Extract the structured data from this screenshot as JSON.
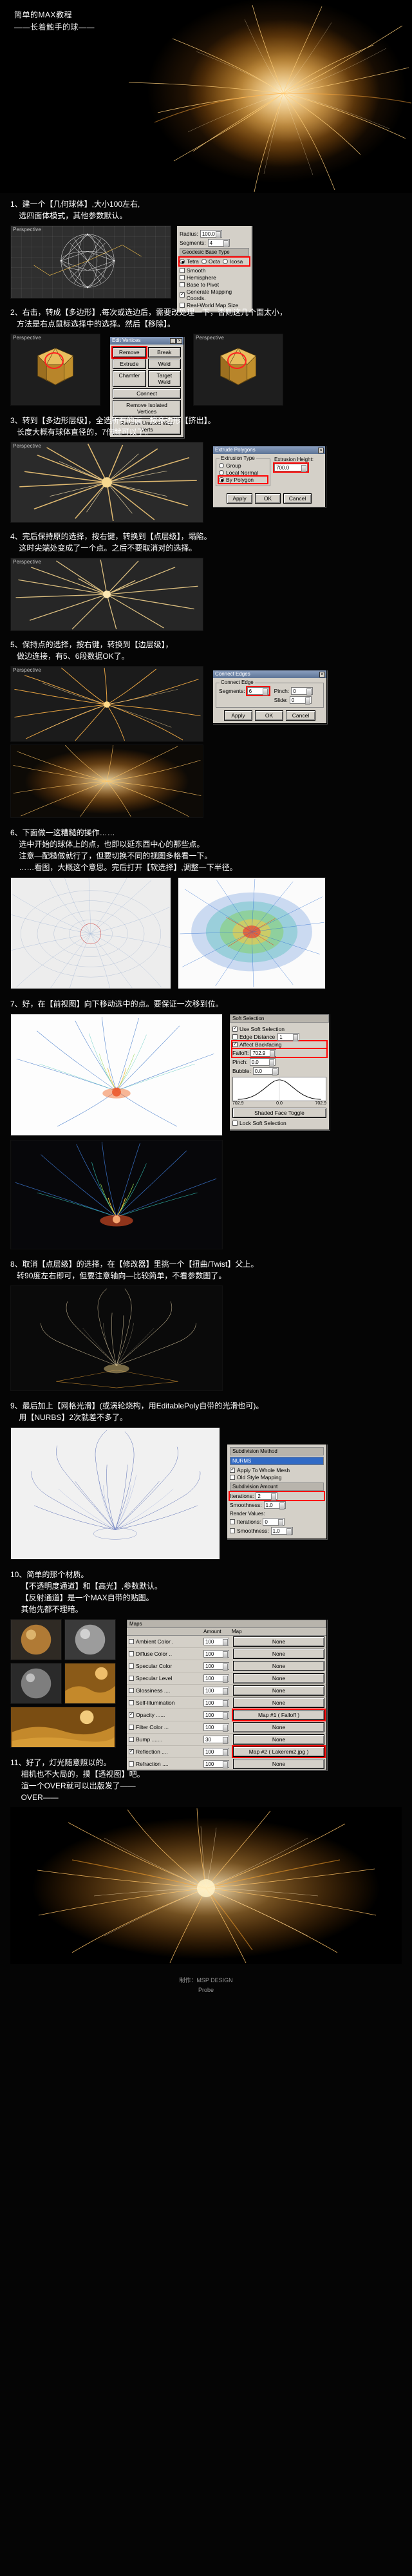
{
  "header": {
    "title_line1": "简单的MAX教程",
    "title_line2": "——长着触手的球——"
  },
  "steps": [
    {
      "id": "step1",
      "text": "1、建一个【几何球体】,大小100左右,\n    选四面体模式，其他参数默认。",
      "viewport_label": "Perspective",
      "dialog": {
        "title": "",
        "params": [
          {
            "label": "Radius:",
            "value": "100.0"
          },
          {
            "label": "Segments:",
            "value": "4"
          }
        ],
        "geodesic_label": "Geodesic Base Type",
        "base_types": [
          "Tetra",
          "Octa",
          "Icosa"
        ],
        "base_type_selected": "Tetra",
        "checks": [
          {
            "label": "Smooth",
            "on": false
          },
          {
            "label": "Hemisphere",
            "on": false
          },
          {
            "label": "Base to Pivot",
            "on": false
          },
          {
            "label": "Generate Mapping Coords.",
            "on": true
          },
          {
            "label": "Real-World Map Size",
            "on": false
          }
        ]
      }
    },
    {
      "id": "step2",
      "text": "2、右击，转成【多边形】,每次或选边后，需要改处理一下，否则这几个面太小，\n   方法是右点鼠标选择中的选择。然后【移除】。",
      "viewport_label": "Perspective",
      "dialog": {
        "title": "Edit Vertices",
        "buttons_pairs": [
          [
            "Remove",
            "Break"
          ],
          [
            "Extrude",
            "Weld"
          ],
          [
            "Chamfer",
            "Target Weld"
          ],
          [
            "Connect",
            ""
          ],
          [
            "Remove Isolated Vertices",
            ""
          ],
          [
            "Remove Unused Map Verts",
            ""
          ]
        ],
        "highlight": "Remove"
      }
    },
    {
      "id": "step3",
      "text": "3、转到【多边形层级】，全选所有的面，按多边形【挤出】。\n   长度大概有球体直径的，7倍就可以了。",
      "viewport_label": "Perspective",
      "dialog": {
        "title": "Extrude Polygons",
        "group_label": "Extrusion Type",
        "options": [
          "Group",
          "Local Normal",
          "By Polygon"
        ],
        "selected": "By Polygon",
        "height_label": "Extrusion Height:",
        "height_value": "700.0",
        "buttons": [
          "Apply",
          "OK",
          "Cancel"
        ]
      }
    },
    {
      "id": "step4",
      "text": "4、完后保持原的选择，按右键，转换到【点层级】，塌陷。\n    这时尖端处变成了一个点。之后不要取消对的选择。",
      "viewport_label": "Perspective"
    },
    {
      "id": "step5",
      "text": "5、保持点的选择，按右键，转换到【边层级】，\n   做边连接，有5、6段数据OK了。",
      "viewport_label": "Perspective",
      "dialog": {
        "title": "Connect Edges",
        "group_label": "Connect Edge",
        "params": [
          {
            "label": "Segments:",
            "value": "6"
          },
          {
            "label": "Pinch:",
            "value": "0"
          },
          {
            "label": "Slide:",
            "value": "0"
          }
        ],
        "buttons": [
          "Apply",
          "OK",
          "Cancel"
        ]
      }
    },
    {
      "id": "step6",
      "text": "6、下面做一这糟糙的操作……\n    选中开始的球体上的点，也即以延东西中心的那些点。\n    注意—配糙做就行了，但要切换不同的视图多格看一下。\n    ……看图，大概这个意思。完后打开【软选择】,调整一下半径。",
      "viewport_label": "Perspective"
    },
    {
      "id": "step7",
      "text": "7、好，在【前视图】向下移动选中的点。要保证一次移到位。",
      "viewport_label": "Front",
      "dialog": {
        "title": "Soft Selection",
        "checks": [
          {
            "label": "Use Soft Selection",
            "on": true
          },
          {
            "label": "Edge Distance",
            "on": false
          },
          {
            "label": "Affect Backfacing",
            "on": true
          }
        ],
        "edge_distance_value": "1",
        "params": [
          {
            "label": "Falloff:",
            "value": "702.9"
          },
          {
            "label": "Pinch:",
            "value": "0.0"
          },
          {
            "label": "Bubble:",
            "value": "0.0"
          }
        ],
        "axis_labels": [
          "702.9",
          "0.0",
          "702.9"
        ],
        "shaded_toggle": "Shaded Face Toggle",
        "lock_label": "Lock Soft Selection"
      }
    },
    {
      "id": "step8",
      "text": "8、取消【点层级】的选择，在【修改器】里挑一个【扭曲/Twist】父上。\n   转90度左右即可，但要注意轴向—比较简单，不看参数图了。",
      "viewport_label": "Perspective"
    },
    {
      "id": "step9",
      "text": "9、最后加上【网格光滑】(或涡轮烧构，用EditablePoly自带的光滑也可)。\n    用【NURBS】2次就差不多了。",
      "viewport_label": "Perspective",
      "dialog": {
        "title": "",
        "sections": [
          {
            "label": "Subdivision Method",
            "select": "NURMS"
          },
          {
            "checks": [
              {
                "label": "Apply To Whole Mesh",
                "on": true
              },
              {
                "label": "Old Style Mapping",
                "on": false
              }
            ]
          },
          {
            "label": "Subdivision Amount",
            "params": [
              {
                "label": "Iterations:",
                "value": "2"
              },
              {
                "label": "Smoothness:",
                "value": "1.0"
              }
            ]
          },
          {
            "label": "Render Values:",
            "params": [
              {
                "label": "Iterations:",
                "value": "0"
              },
              {
                "label": "Smoothness:",
                "value": "1.0"
              }
            ]
          }
        ]
      }
    },
    {
      "id": "step10",
      "text": "10、简单的那个材质。\n     【不透明度通道】和【高光】,参数默认。\n     【反射通道】是一个MAX自带的贴图。\n     其他先都不理暗。",
      "dialog": {
        "title": "Maps",
        "columns": [
          "",
          "Amount",
          "Map"
        ],
        "rows": [
          {
            "on": false,
            "name": "Ambient Color .",
            "amount": "100",
            "map": "None"
          },
          {
            "on": false,
            "name": "Diffuse Color ..",
            "amount": "100",
            "map": "None"
          },
          {
            "on": false,
            "name": "Specular Color",
            "amount": "100",
            "map": "None"
          },
          {
            "on": false,
            "name": "Specular Level",
            "amount": "100",
            "map": "None"
          },
          {
            "on": false,
            "name": "Glossiness ....",
            "amount": "100",
            "map": "None"
          },
          {
            "on": false,
            "name": "Self-Illumination",
            "amount": "100",
            "map": "None"
          },
          {
            "on": true,
            "name": "Opacity ......",
            "amount": "100",
            "map": "Map #1 ( Falloff )",
            "hl": true
          },
          {
            "on": false,
            "name": "Filter Color ...",
            "amount": "100",
            "map": "None"
          },
          {
            "on": false,
            "name": "Bump .......",
            "amount": "30",
            "map": "None"
          },
          {
            "on": true,
            "name": "Reflection ....",
            "amount": "100",
            "map": "Map #2 ( Lakerem2.jpg )",
            "hl": true
          },
          {
            "on": false,
            "name": "Refraction ....",
            "amount": "100",
            "map": "None"
          }
        ]
      }
    },
    {
      "id": "step11",
      "text": "11、好了，灯光随意照以的。\n     相机也不大局的，摸【透视图】吧。\n     渲一个OVER就可以出版发了——\n     OVER——"
    }
  ],
  "footer": {
    "line1": "制作：MSP DESIGN",
    "line2": "Probe"
  },
  "colors": {
    "accent_orange": "#ff9a1e",
    "highlight_red": "#ff2020",
    "dialog_bg": "#d4d0c8",
    "titlebar": "#5d7496"
  }
}
